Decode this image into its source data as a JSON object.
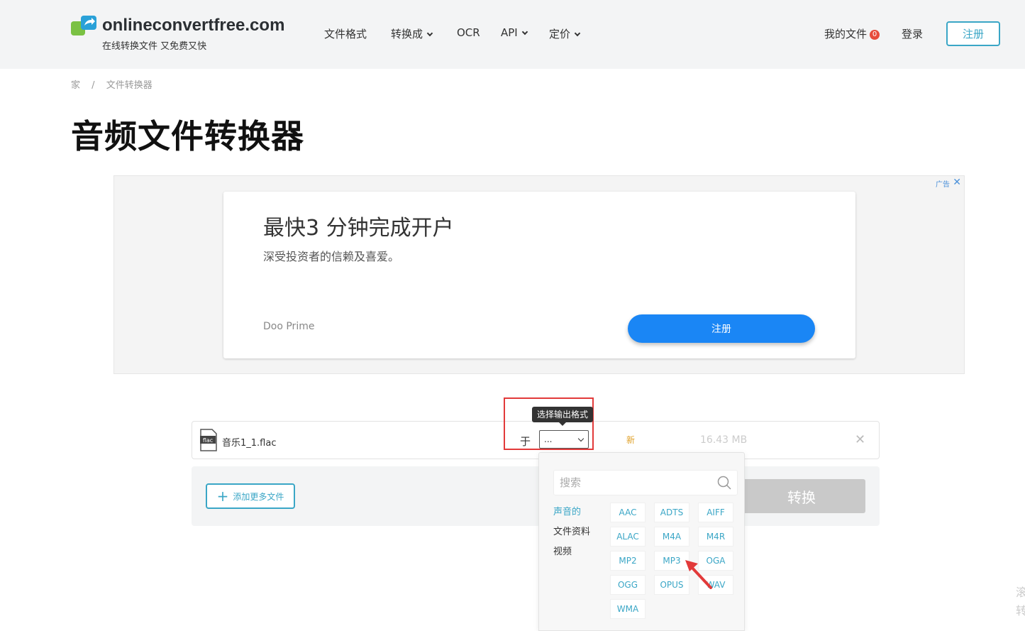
{
  "header": {
    "site_name": "onlineconvertfree.com",
    "tagline": "在线转换文件 又免费又快",
    "nav": {
      "formats": "文件格式",
      "convert_to": "转换成",
      "ocr": "OCR",
      "api": "API",
      "pricing": "定价"
    },
    "my_files": "我的文件",
    "my_files_count": "0",
    "login": "登录",
    "signup": "注册"
  },
  "breadcrumb": {
    "home": "家",
    "separator": "/",
    "current": "文件转换器"
  },
  "page_title": "音频文件转换器",
  "ad": {
    "label": "广告",
    "close": "✕",
    "headline": "最快3 分钟完成开户",
    "subtext": "深受投资者的信赖及喜爱。",
    "brand": "Doo Prime",
    "cta": "注册"
  },
  "file": {
    "icon_text": "flac",
    "name": "音乐1_1.flac",
    "to_label": "于",
    "selected_format": "...",
    "status_badge": "新",
    "size": "16.43 MB",
    "remove": "✕"
  },
  "tooltip": "选择输出格式",
  "actions": {
    "add_more": "添加更多文件",
    "add_icon": "+",
    "convert": "转换"
  },
  "dropdown": {
    "search_placeholder": "搜索",
    "categories": [
      "声音的",
      "文件资料",
      "视频"
    ],
    "formats": [
      "AAC",
      "ADTS",
      "AIFF",
      "ALAC",
      "M4A",
      "M4R",
      "MP2",
      "MP3",
      "OGA",
      "OGG",
      "OPUS",
      "WAV",
      "WMA"
    ]
  },
  "edge_text": "滚转",
  "colors": {
    "accent": "#3aa6c6",
    "highlight": "#e23a3a",
    "ad_button": "#1a86f5",
    "new_badge": "#e0a12a"
  }
}
